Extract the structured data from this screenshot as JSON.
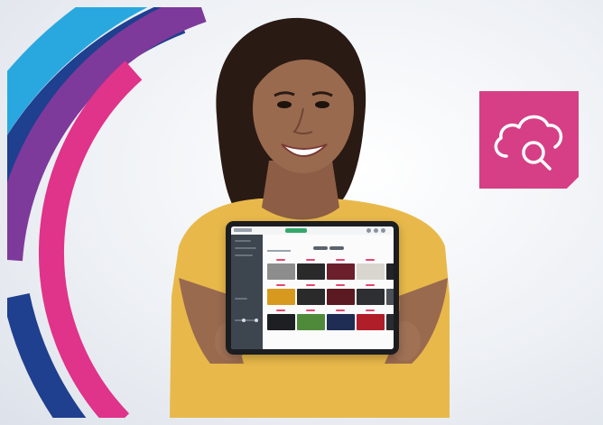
{
  "scene": {
    "subject": "",
    "colors": {
      "arc_cyan": "#29a8df",
      "arc_navy": "#1f3f8f",
      "arc_purple": "#7d3a9a",
      "arc_magenta": "#e0338a",
      "shirt": "#e8b94a",
      "skin": "#9a6a4f",
      "hair": "#2a1a14",
      "badge": "#d63f86"
    }
  },
  "badge": {
    "icon": "cloud-search-icon"
  },
  "tablet": {
    "app_swatches": [
      "#8d8d8d",
      "#2a2a2a",
      "#6b1f2b",
      "#d9d6d0",
      "#222428",
      "#d79a1f",
      "#2a2a2a",
      "#5b1a22",
      "#2d2f33",
      "#4c5157",
      "#1d1f23",
      "#4f8a3a",
      "#1f2d55",
      "#b01e2a",
      "#2b2c30"
    ]
  }
}
